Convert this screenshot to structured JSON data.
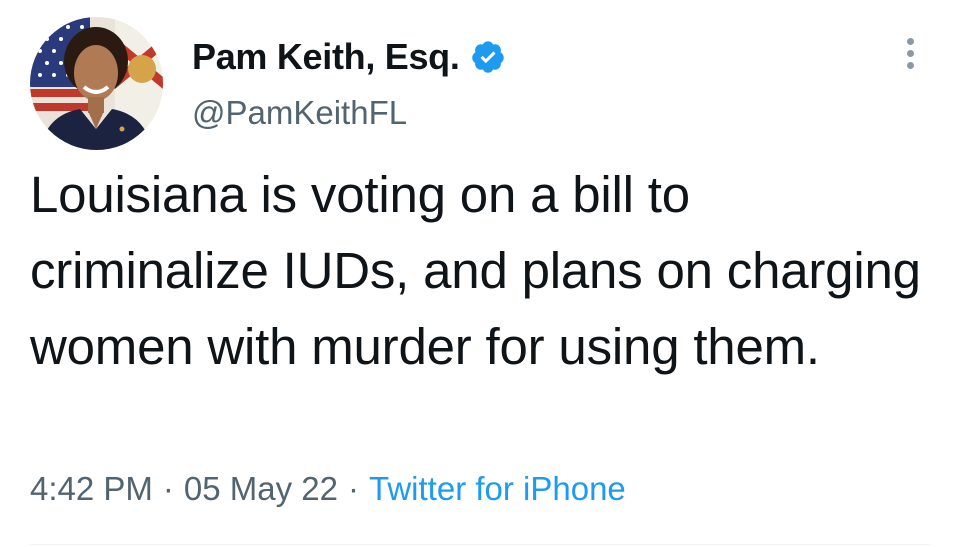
{
  "tweet": {
    "author": {
      "display_name": "Pam Keith, Esq.",
      "handle": "@PamKeithFL",
      "verified_icon": "verified-badge-icon",
      "avatar_icon": "profile-photo"
    },
    "text": "Louisiana is voting on a bill to criminalize IUDs, and plans on charging women with murder for using them.",
    "time": "4:42 PM",
    "date": "05 May 22",
    "separator": "·",
    "source": "Twitter for iPhone"
  },
  "colors": {
    "text_primary": "#0f1419",
    "text_secondary": "#536471",
    "accent_blue": "#1d9bf0"
  },
  "icons": {
    "more_options": "more-options-icon"
  }
}
